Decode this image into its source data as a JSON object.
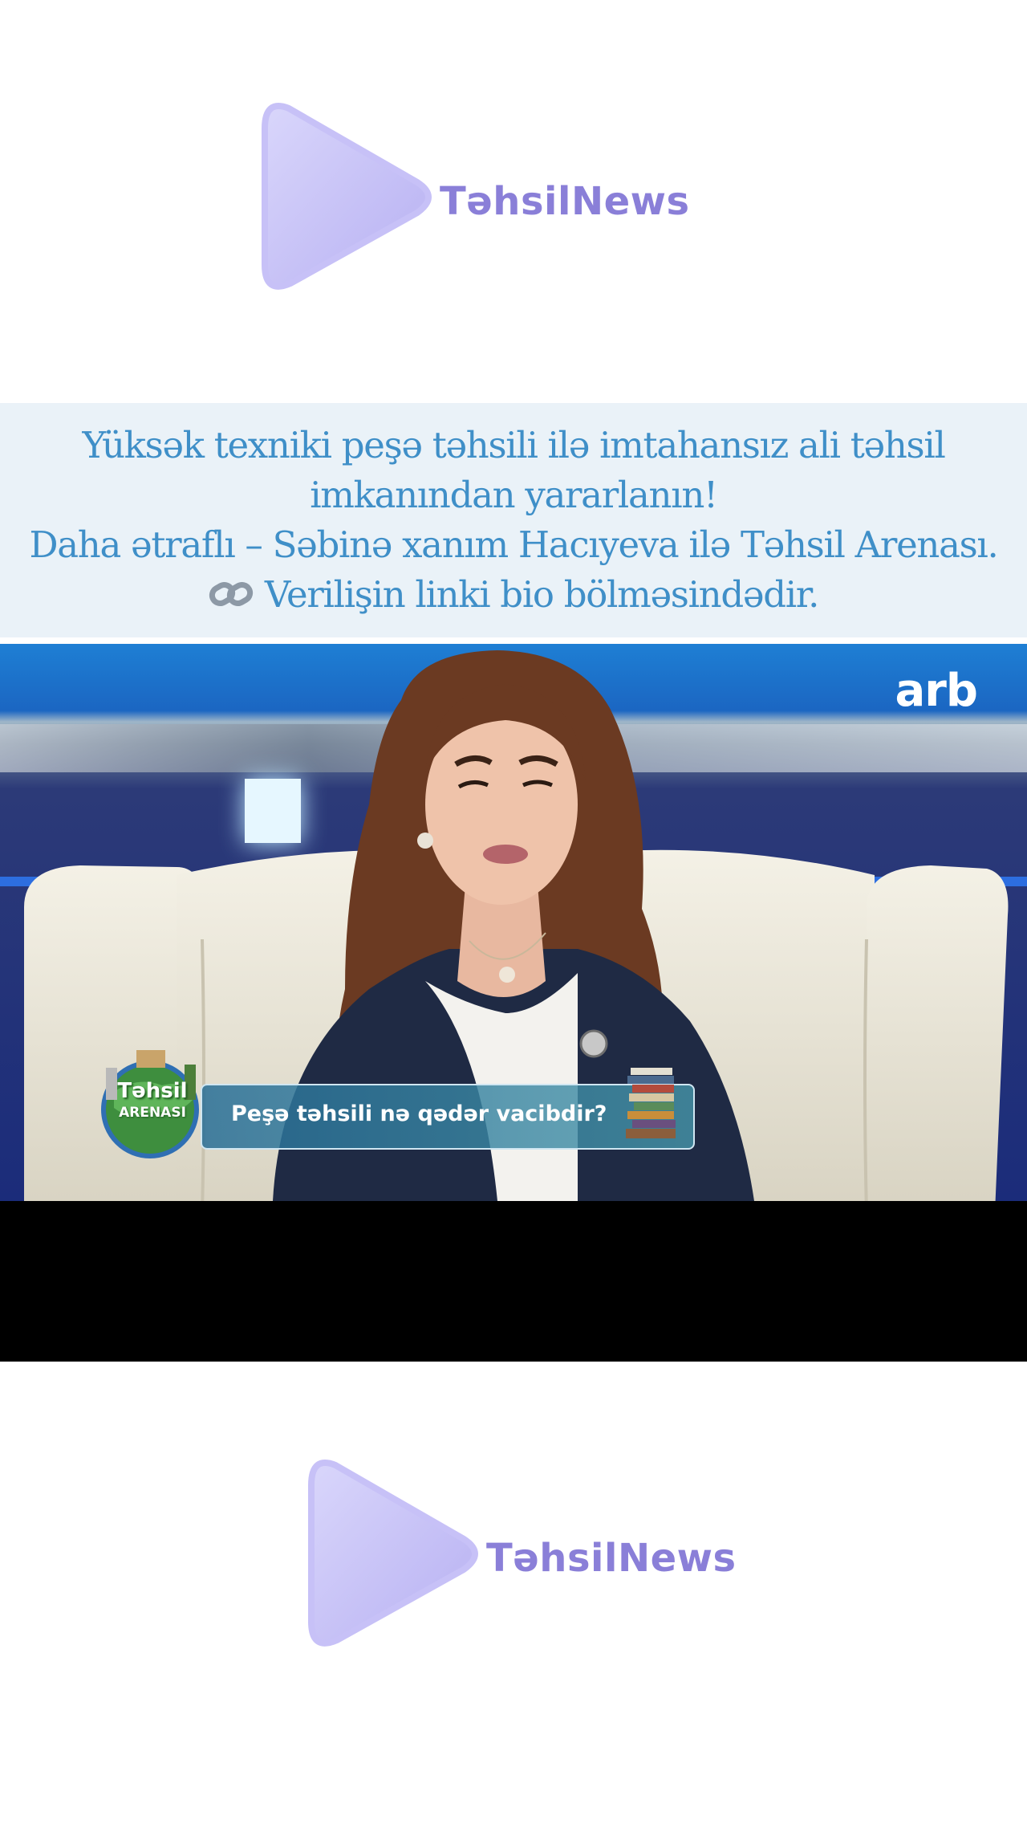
{
  "brand": {
    "name": "TəhsilNews",
    "accent_color": "#8a7fd8",
    "icon": "play-triangle-icon"
  },
  "caption": {
    "lines": [
      "Yüksək texniki peşə təhsili ilə imtahansız ali təhsil",
      "imkanından yararlanın!",
      "Daha ətraflı – Səbinə xanım Hacıyeva ilə Təhsil Arenası.",
      "Verilişin linki bio bölməsindədir."
    ],
    "link_icon": "link-icon",
    "text_color": "#3f8fc8",
    "background": "#eaf2f8"
  },
  "video": {
    "channel_logo": "arb",
    "show_badge": {
      "line1": "Təhsil",
      "line2": "ARENASI"
    },
    "lower_third": "Peşə təhsili nə qədər vacibdir?"
  }
}
